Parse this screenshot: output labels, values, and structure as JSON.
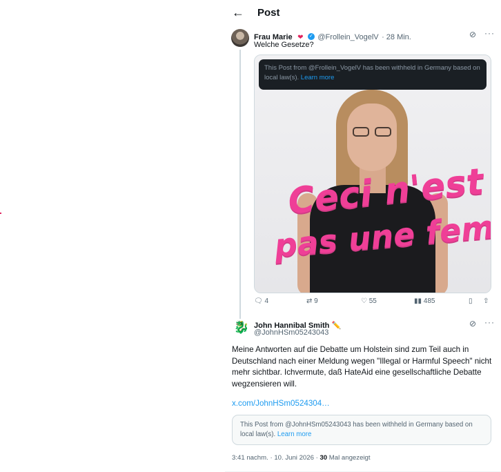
{
  "header": {
    "back_icon": "←",
    "title": "Post"
  },
  "post1": {
    "author_name": "Frau Marie",
    "heart_badge": "❤",
    "handle": "@Frollein_VogelV",
    "time": "· 28 Min.",
    "text": "Welche Gesetze?",
    "withheld_notice": "This Post from @Frollein_VogelV has been withheld in Germany based on local law(s).",
    "learn_more": "Learn more",
    "image_text_line1": "Ceci n'est",
    "image_text_line2": "pas une femme",
    "replies": "4",
    "reposts": "9",
    "likes": "55",
    "views": "485"
  },
  "post2": {
    "author_name": "John Hannibal Smith ✏️",
    "handle": "@JohnHSm05243043",
    "text": "Meine Antworten auf die Debatte um Holstein sind zum Teil auch in Deutschland nach einer Meldung wegen \"Illegal or Harmful Speech\" nicht mehr sichtbar. Ichvermute, daß HateAid eine gesellschaftliche Debatte wegzensieren will.",
    "url": "x.com/JohnHSm0524304…",
    "withheld_notice": "This Post from @JohnHSm05243043 has been withheld in Germany based on local law(s).",
    "learn_more": "Learn more",
    "timestamp": "3:41 nachm. · 10. Juni 2026 · ",
    "view_count": "30",
    "views_label": " Mal angezeigt"
  },
  "icons": {
    "grok": "grok-icon",
    "more": "more-icon",
    "reply": "reply-icon",
    "repost": "repost-icon",
    "like": "heart-icon",
    "views": "views-icon",
    "bookmark": "bookmark-icon",
    "share": "share-icon"
  },
  "colors": {
    "accent": "#1d9bf0",
    "graffiti": "#ef3f97",
    "text": "#0f1419",
    "muted": "#536471"
  }
}
